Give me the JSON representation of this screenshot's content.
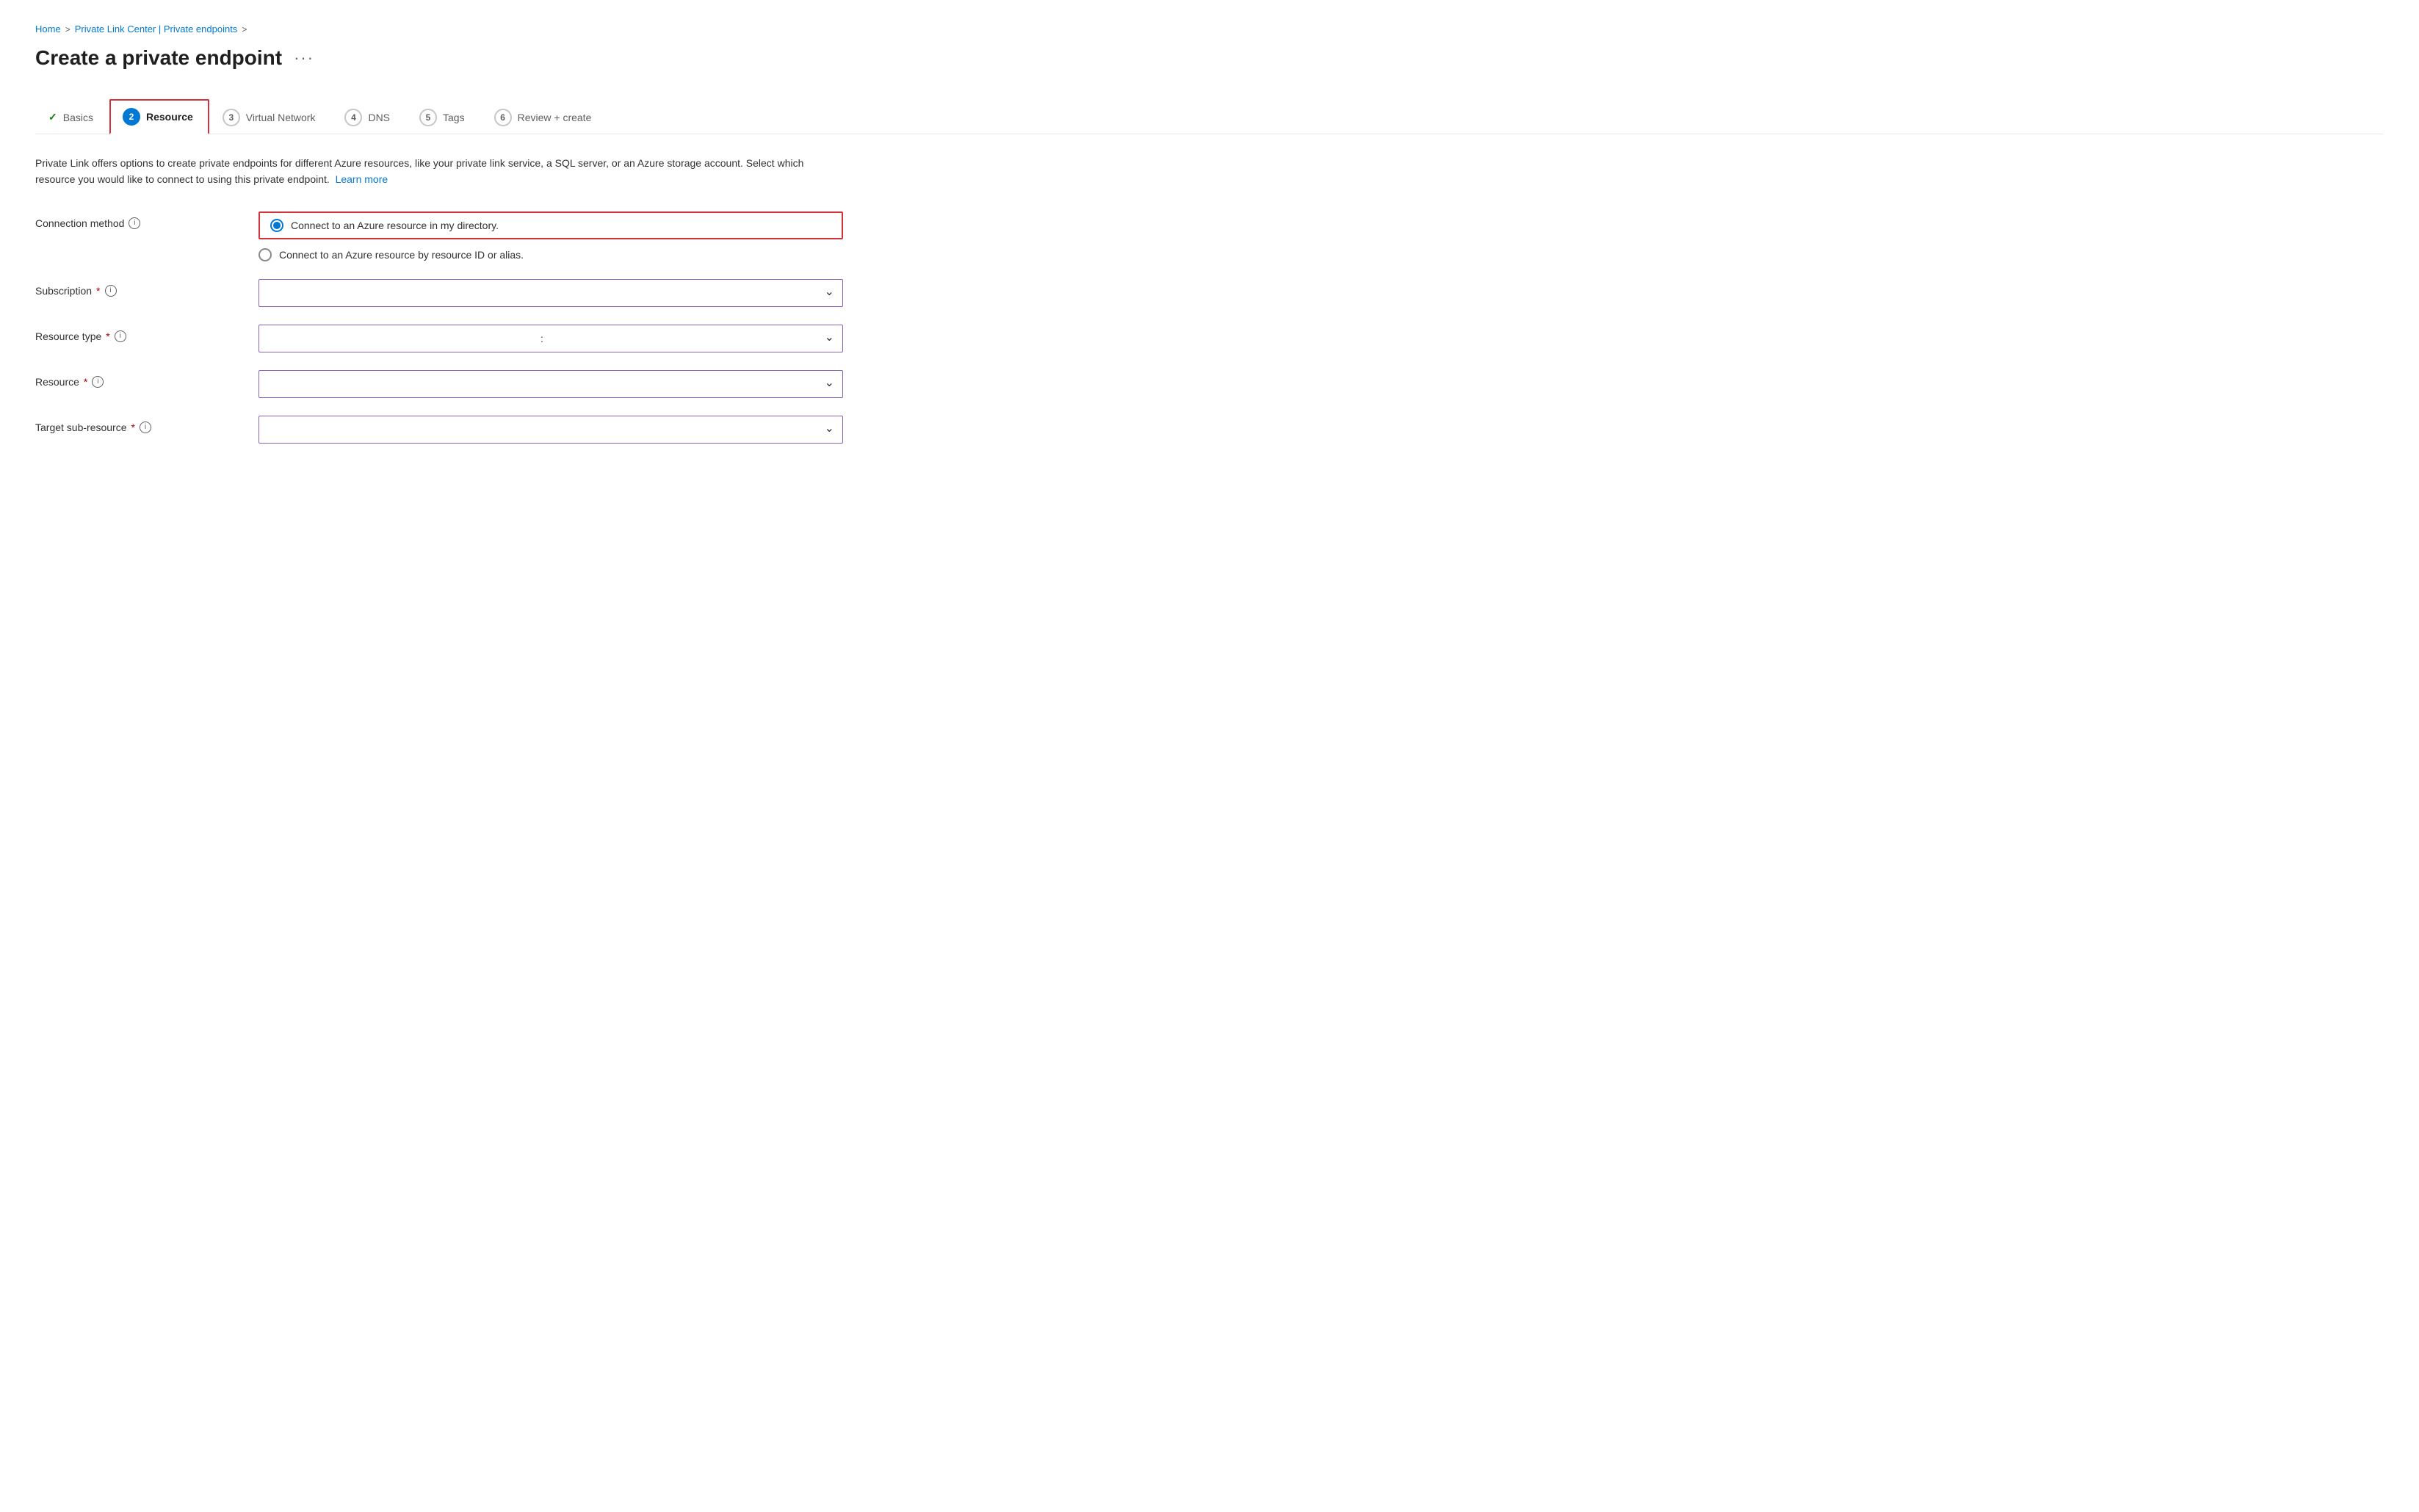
{
  "breadcrumb": {
    "items": [
      {
        "label": "Home",
        "href": "#"
      },
      {
        "label": "Private Link Center | Private endpoints",
        "href": "#"
      }
    ],
    "sep": ">"
  },
  "header": {
    "title": "Create a private endpoint",
    "menu_dots": "···"
  },
  "steps": [
    {
      "id": "basics",
      "number": null,
      "label": "Basics",
      "state": "completed",
      "check": "✓"
    },
    {
      "id": "resource",
      "number": "2",
      "label": "Resource",
      "state": "active"
    },
    {
      "id": "virtual-network",
      "number": "3",
      "label": "Virtual Network",
      "state": "inactive"
    },
    {
      "id": "dns",
      "number": "4",
      "label": "DNS",
      "state": "inactive"
    },
    {
      "id": "tags",
      "number": "5",
      "label": "Tags",
      "state": "inactive"
    },
    {
      "id": "review-create",
      "number": "6",
      "label": "Review + create",
      "state": "inactive"
    }
  ],
  "description": {
    "text": "Private Link offers options to create private endpoints for different Azure resources, like your private link service, a SQL server, or an Azure storage account. Select which resource you would like to connect to using this private endpoint.",
    "learn_more_label": "Learn more",
    "learn_more_href": "#"
  },
  "form": {
    "connection_method": {
      "label": "Connection method",
      "options": [
        {
          "id": "directory",
          "label": "Connect to an Azure resource in my directory.",
          "selected": true
        },
        {
          "id": "resource-id",
          "label": "Connect to an Azure resource by resource ID or alias.",
          "selected": false
        }
      ]
    },
    "subscription": {
      "label": "Subscription",
      "required": true,
      "value": "",
      "placeholder": ""
    },
    "resource_type": {
      "label": "Resource type",
      "required": true,
      "value": ":",
      "placeholder": ":"
    },
    "resource": {
      "label": "Resource",
      "required": true,
      "value": "",
      "placeholder": ""
    },
    "target_sub_resource": {
      "label": "Target sub-resource",
      "required": true,
      "value": "",
      "placeholder": ""
    }
  },
  "icons": {
    "info": "i",
    "chevron_down": "⌄",
    "check": "✓",
    "ellipsis": "···"
  }
}
